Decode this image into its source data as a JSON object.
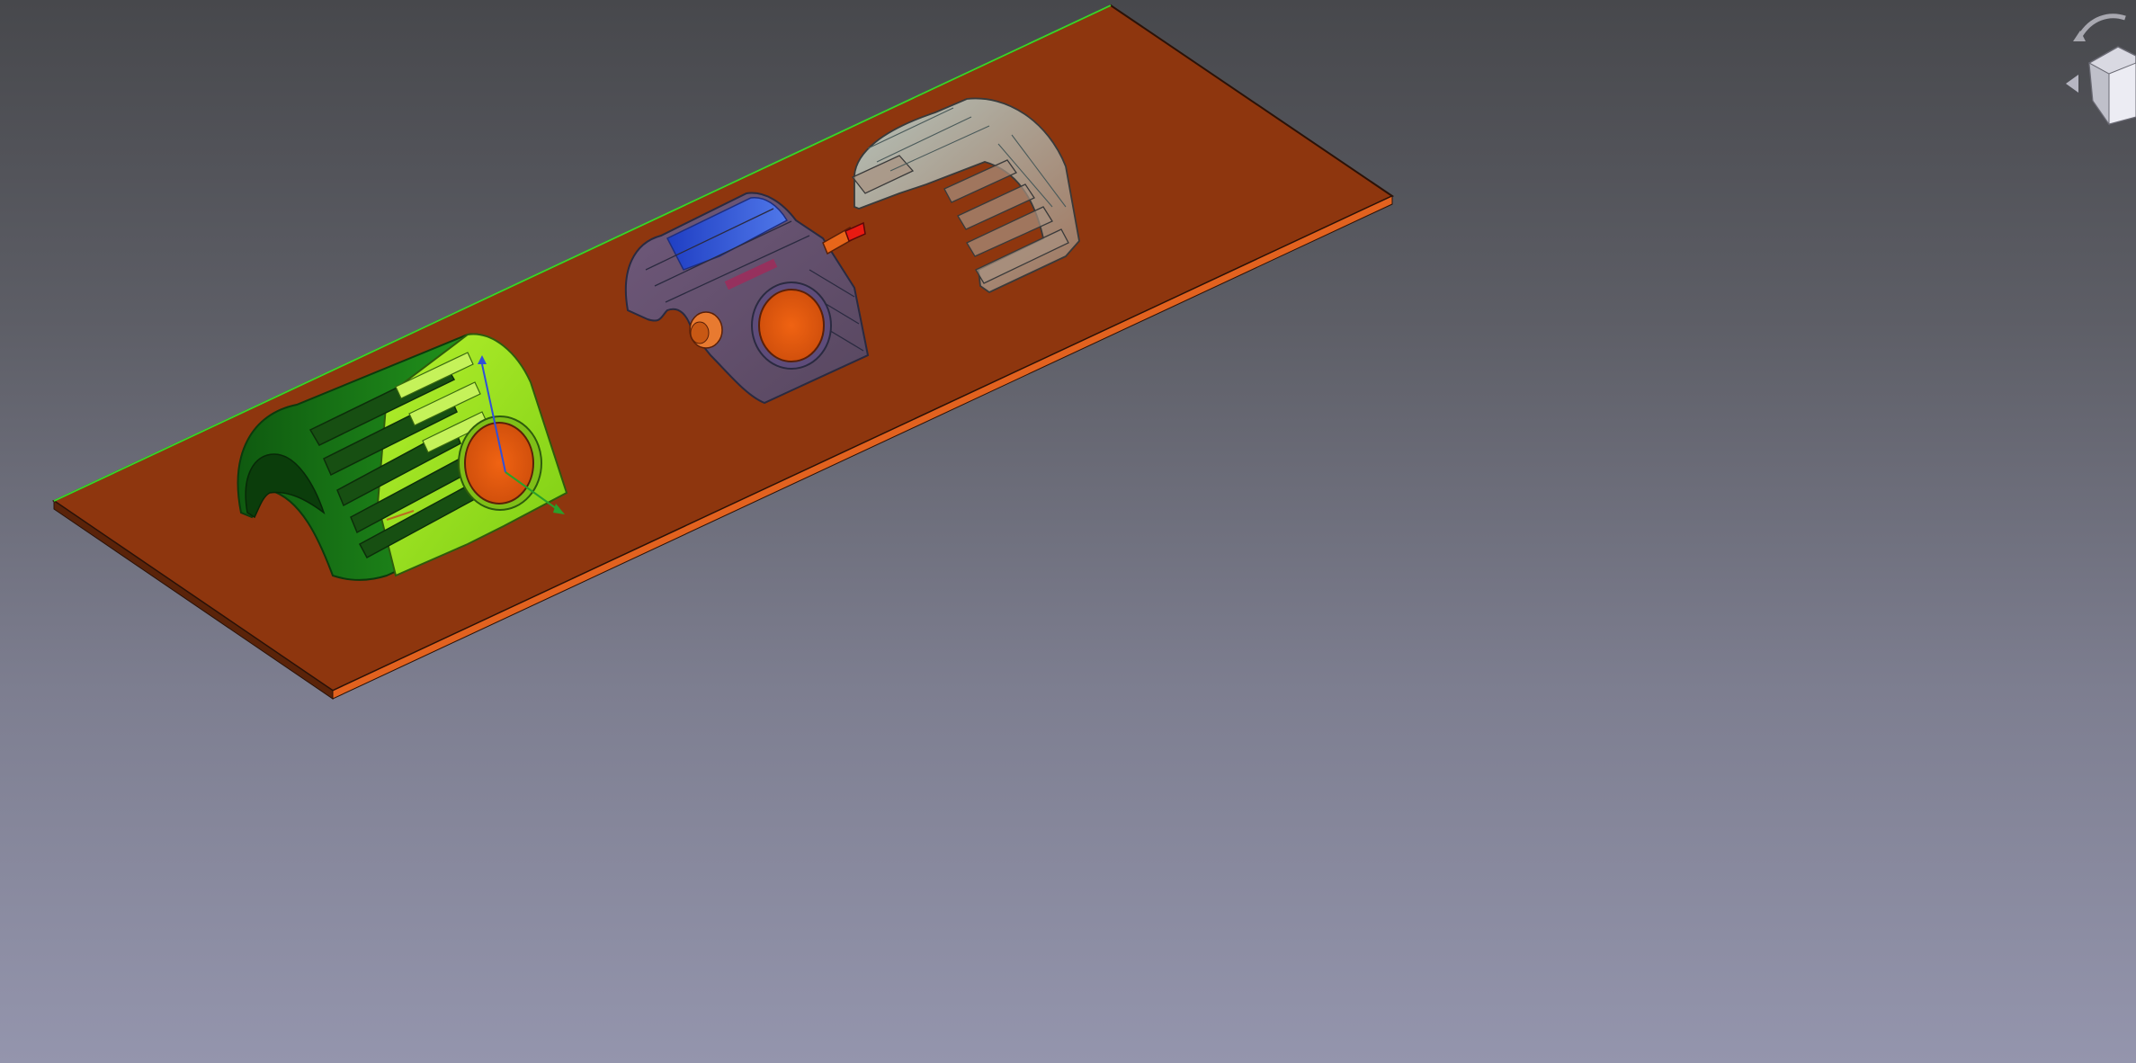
{
  "app": {
    "view": "3D viewport",
    "projection": "isometric"
  },
  "scene": {
    "objects": [
      {
        "name": "base-plate",
        "color": "#8e360e",
        "edge_color": "#e0621e"
      },
      {
        "name": "green-housing",
        "colors": [
          "#1f8a1a",
          "#8fe01a"
        ],
        "hole_color": "#e8590f"
      },
      {
        "name": "blue-transparent-housing",
        "colors": [
          "#2850e0",
          "#6b5a7c"
        ],
        "hole_color": "#e8590f"
      },
      {
        "name": "cyan-transparent-shell",
        "colors": [
          "#9fd6d8",
          "#9a8c82"
        ]
      }
    ]
  },
  "navigation_cube": {
    "icons": [
      "rotate-arrow-icon",
      "triangle-left-icon",
      "view-cube-icon"
    ]
  }
}
